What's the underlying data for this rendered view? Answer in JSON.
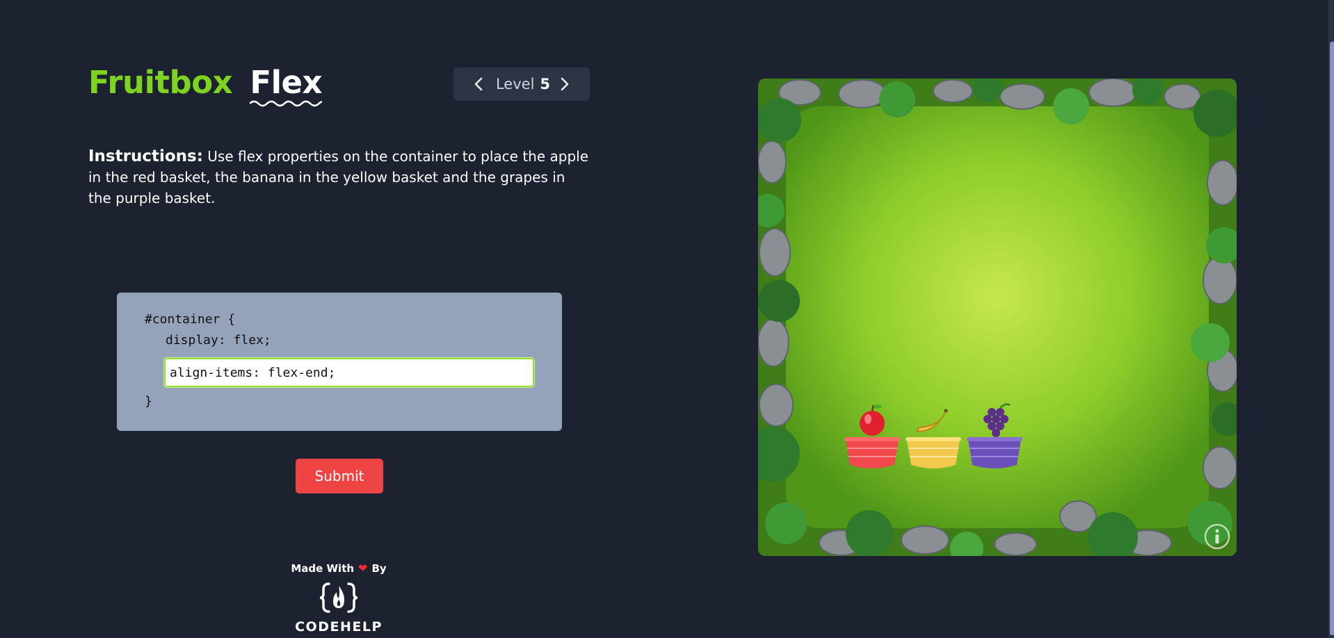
{
  "header": {
    "title_part1": "Fruitbox",
    "title_part2": "Flex",
    "level_label": "Level",
    "level_number": "5"
  },
  "instructions": {
    "label": "Instructions:",
    "text": " Use flex properties on the container to place the apple in the red basket, the banana in the yellow basket and the grapes in the purple basket."
  },
  "editor": {
    "line1": "#container {",
    "line2": "display: flex;",
    "input_value": "align-items: flex-end;",
    "line_close": "}"
  },
  "submit_label": "Submit",
  "footer": {
    "made_with": "Made With",
    "by": "By",
    "brand": "CODEHELP"
  },
  "board": {
    "fruits": [
      "apple",
      "banana",
      "grapes"
    ],
    "basket_colors": [
      "#f0484c",
      "#f2c94c",
      "#6b4fbb"
    ],
    "icon": "info-icon"
  },
  "colors": {
    "background": "#1c2230",
    "accent_green": "#7ed321",
    "submit_red": "#ef4444",
    "editor_bg": "#94a3ba"
  }
}
